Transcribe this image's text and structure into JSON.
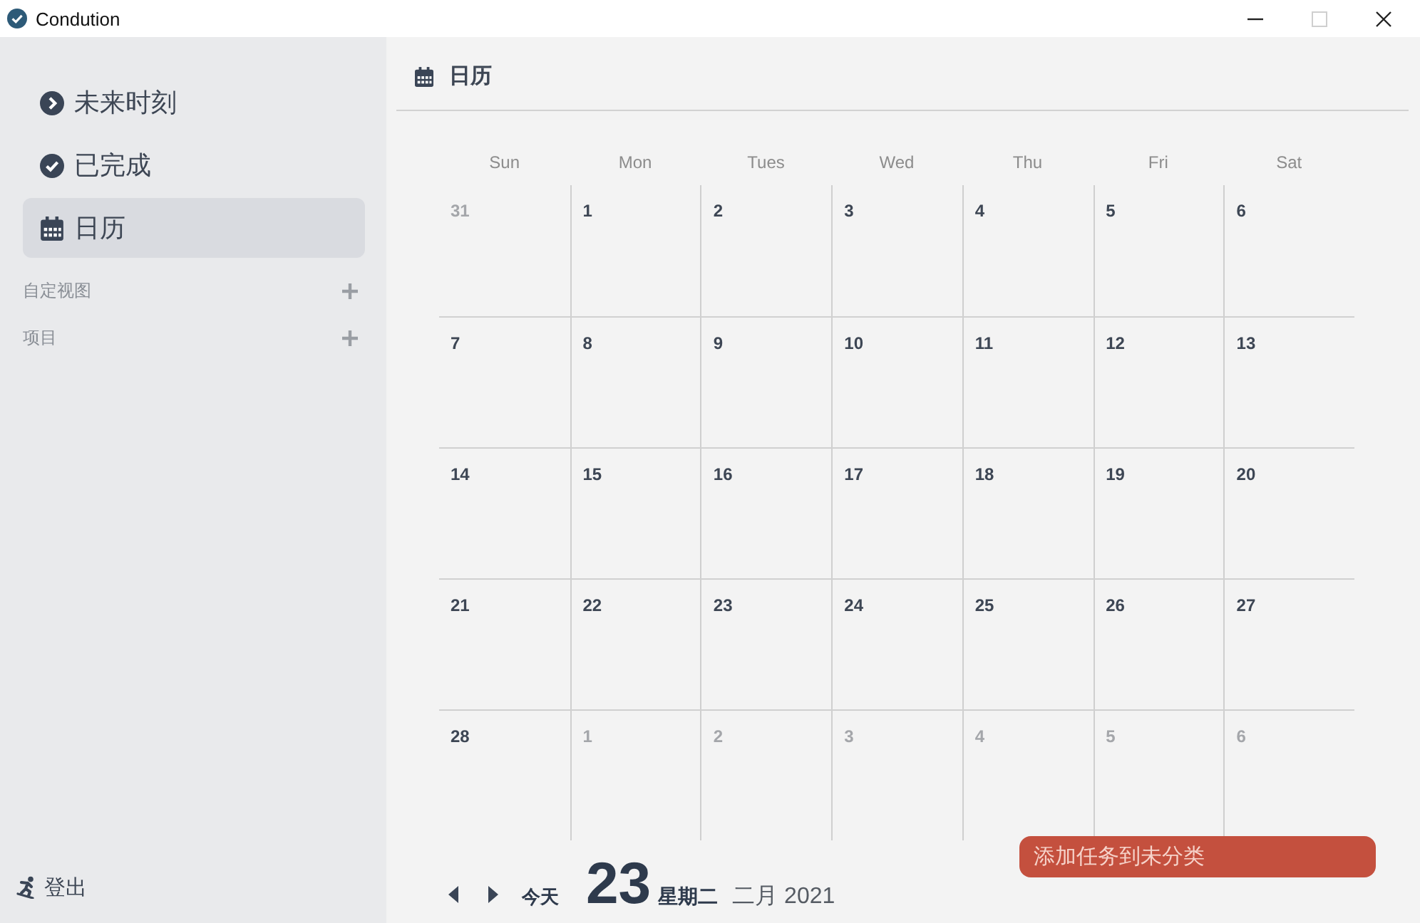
{
  "window": {
    "title": "Condution",
    "controls": [
      {
        "kind": "minimize",
        "disabled": false
      },
      {
        "kind": "maximize",
        "disabled": true
      },
      {
        "kind": "close",
        "disabled": false
      }
    ]
  },
  "sidebar": {
    "items": [
      {
        "kind": "chevron",
        "label": "未来时刻",
        "selected": false
      },
      {
        "kind": "check",
        "label": "已完成",
        "selected": false
      },
      {
        "kind": "calendar",
        "label": "日历",
        "selected": true
      }
    ],
    "sections": [
      {
        "label": "自定视图"
      },
      {
        "label": "项目"
      }
    ],
    "logout": {
      "label": "登出"
    }
  },
  "calendar": {
    "title": "日历",
    "weekdays": [
      "Sun",
      "Mon",
      "Tues",
      "Wed",
      "Thu",
      "Fri",
      "Sat"
    ],
    "weeks": [
      {
        "days": [
          {
            "day": "31",
            "in_month": false
          },
          {
            "day": "1",
            "in_month": true
          },
          {
            "day": "2",
            "in_month": true
          },
          {
            "day": "3",
            "in_month": true
          },
          {
            "day": "4",
            "in_month": true
          },
          {
            "day": "5",
            "in_month": true
          },
          {
            "day": "6",
            "in_month": true
          }
        ]
      },
      {
        "days": [
          {
            "day": "7",
            "in_month": true
          },
          {
            "day": "8",
            "in_month": true
          },
          {
            "day": "9",
            "in_month": true
          },
          {
            "day": "10",
            "in_month": true
          },
          {
            "day": "11",
            "in_month": true
          },
          {
            "day": "12",
            "in_month": true
          },
          {
            "day": "13",
            "in_month": true
          }
        ]
      },
      {
        "days": [
          {
            "day": "14",
            "in_month": true
          },
          {
            "day": "15",
            "in_month": true
          },
          {
            "day": "16",
            "in_month": true
          },
          {
            "day": "17",
            "in_month": true
          },
          {
            "day": "18",
            "in_month": true
          },
          {
            "day": "19",
            "in_month": true
          },
          {
            "day": "20",
            "in_month": true
          }
        ]
      },
      {
        "days": [
          {
            "day": "21",
            "in_month": true
          },
          {
            "day": "22",
            "in_month": true
          },
          {
            "day": "23",
            "in_month": true
          },
          {
            "day": "24",
            "in_month": true
          },
          {
            "day": "25",
            "in_month": true
          },
          {
            "day": "26",
            "in_month": true
          },
          {
            "day": "27",
            "in_month": true
          }
        ]
      },
      {
        "days": [
          {
            "day": "28",
            "in_month": true
          },
          {
            "day": "1",
            "in_month": false
          },
          {
            "day": "2",
            "in_month": false
          },
          {
            "day": "3",
            "in_month": false
          },
          {
            "day": "4",
            "in_month": false
          },
          {
            "day": "5",
            "in_month": false
          },
          {
            "day": "6",
            "in_month": false
          }
        ]
      }
    ],
    "footer": {
      "today": "今天",
      "day": "23",
      "weekday": "星期二",
      "month_year": "二月 2021"
    },
    "add_task_button": "添加任务到未分类"
  }
}
